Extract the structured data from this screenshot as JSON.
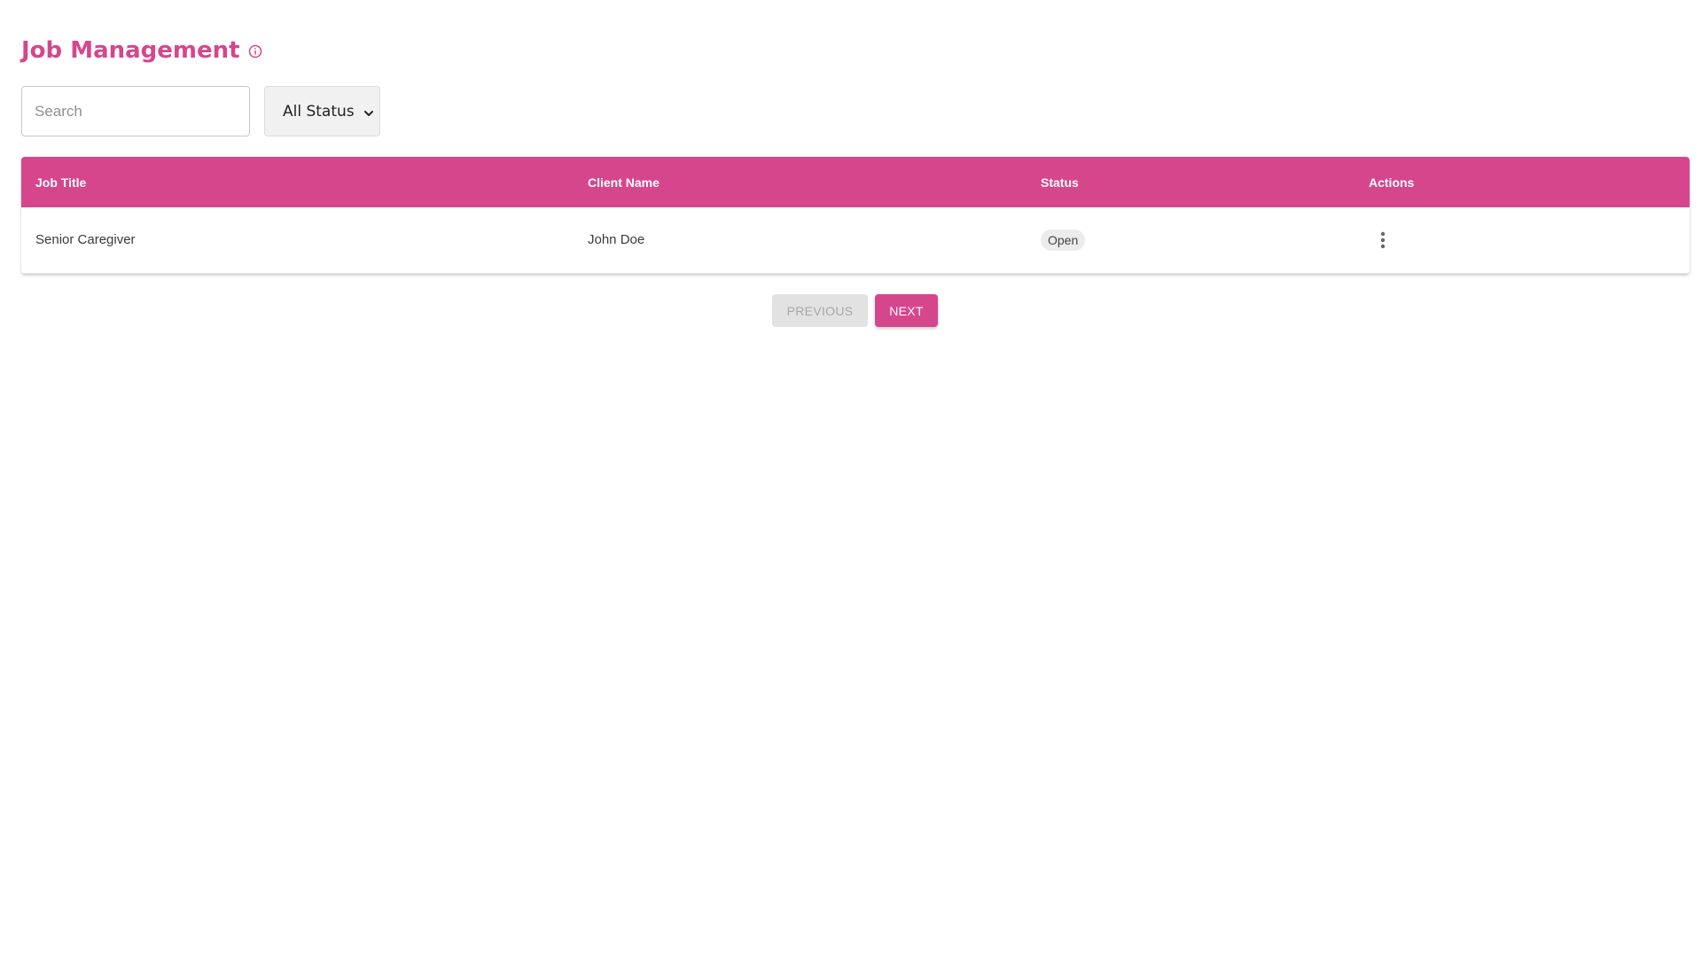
{
  "header": {
    "title": "Job Management",
    "info_icon": "info-circle-icon"
  },
  "filters": {
    "search_placeholder": "Search",
    "search_value": "",
    "status_selected": "All Status",
    "status_chevron_icon": "chevron-down-icon"
  },
  "table": {
    "columns": [
      "Job Title",
      "Client Name",
      "Status",
      "Actions"
    ],
    "rows": [
      {
        "job_title": "Senior Caregiver",
        "client_name": "John Doe",
        "status": "Open",
        "actions_icon": "more-vertical-icon"
      }
    ]
  },
  "pagination": {
    "previous_label": "Previous",
    "next_label": "Next"
  },
  "colors": {
    "accent": "#d6468d",
    "badge_bg": "#ececec",
    "disabled_bg": "#e2e2e2"
  }
}
